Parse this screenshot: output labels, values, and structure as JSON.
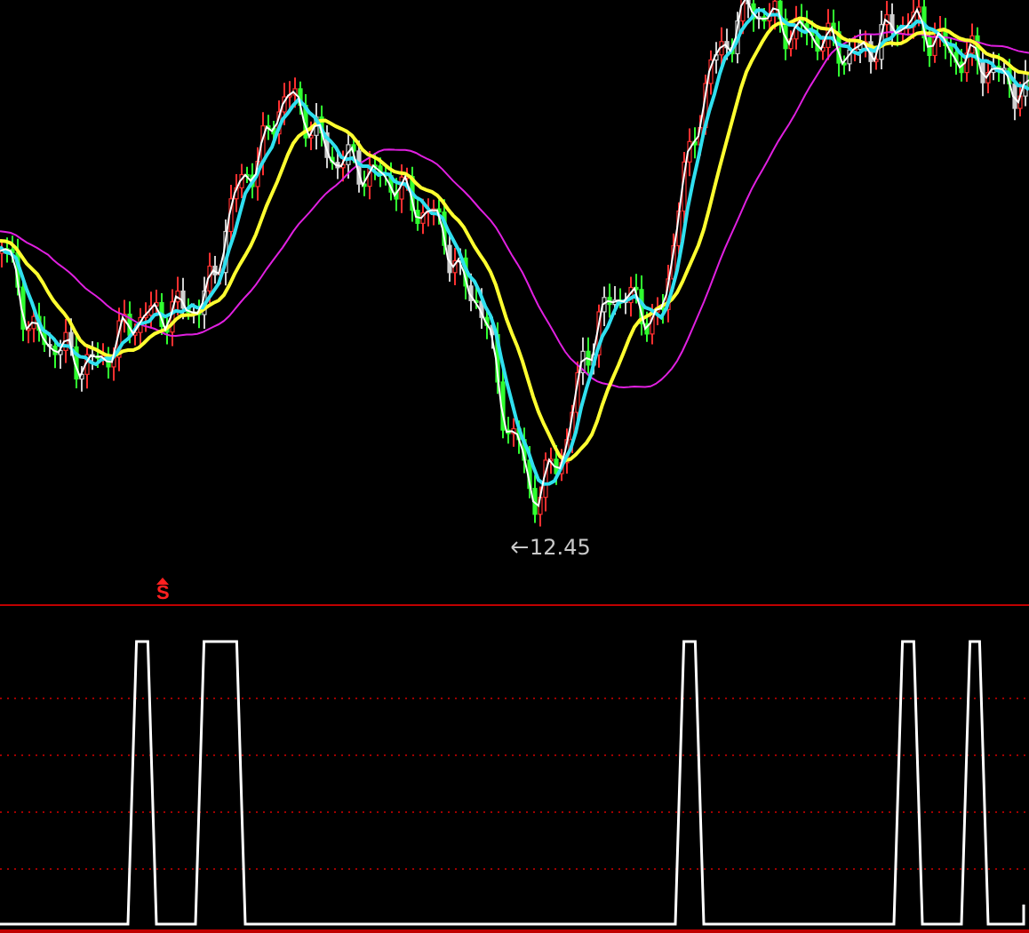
{
  "price_panel": {
    "low_label": "12.45"
  },
  "signal_panel": {
    "marker": "S"
  }
}
